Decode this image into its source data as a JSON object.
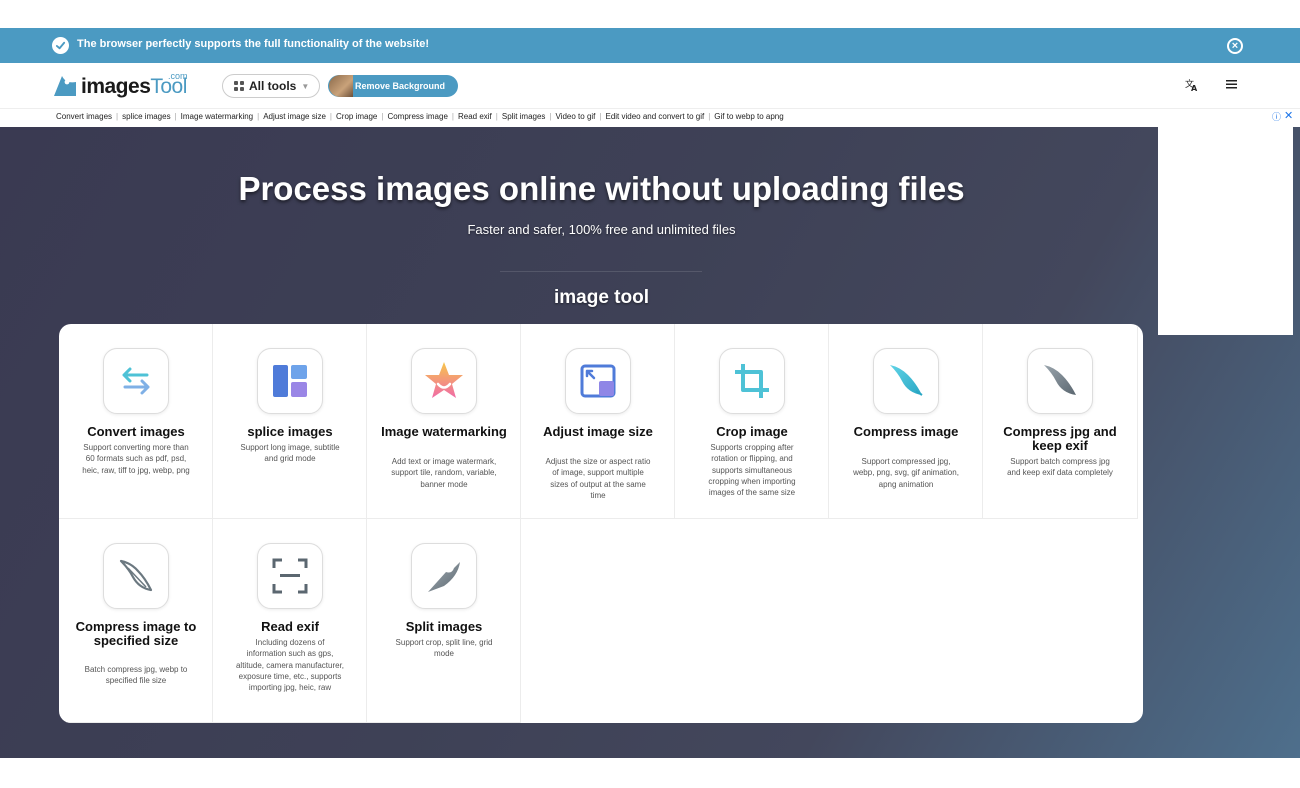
{
  "notice": {
    "message": "The browser perfectly supports the full functionality of the website!"
  },
  "header": {
    "logo": {
      "text_main": "images",
      "text_tool": "Tool",
      "text_com": ".com"
    },
    "all_tools_label": "All tools",
    "remove_background_label": "Remove Background"
  },
  "quicklinks": [
    "Convert images",
    "splice images",
    "Image watermarking",
    "Adjust image size",
    "Crop image",
    "Compress image",
    "Read exif",
    "Split images",
    "Video to gif",
    "Edit video and convert to gif",
    "Gif to webp to apng"
  ],
  "hero": {
    "title": "Process images online without uploading files",
    "subtitle": "Faster and safer, 100% free and unlimited files",
    "section_title": "image tool"
  },
  "tools": [
    {
      "name": "Convert images",
      "desc": "Support converting more than 60 formats such as pdf, psd, heic, raw, tiff to jpg, webp, png",
      "icon": "convert-arrows-icon"
    },
    {
      "name": "splice images",
      "desc": "Support long image, subtitle and grid mode",
      "icon": "splice-layout-icon"
    },
    {
      "name": "Image watermarking",
      "desc": "Add text or image watermark, support tile, random, variable, banner mode",
      "icon": "watermark-star-icon"
    },
    {
      "name": "Adjust image size",
      "desc": "Adjust the size or aspect ratio of image, support multiple sizes of output at the same time",
      "icon": "resize-icon"
    },
    {
      "name": "Crop image",
      "desc": "Supports cropping after rotation or flipping, and supports simultaneous cropping when importing images of the same size",
      "icon": "crop-icon"
    },
    {
      "name": "Compress image",
      "desc": "Support compressed jpg, webp, png, svg, gif animation, apng animation",
      "icon": "feather-icon"
    },
    {
      "name": "Compress jpg and keep exif",
      "desc": "Support batch compress jpg and keep exif data completely",
      "icon": "feather-gray-icon"
    },
    {
      "name": "Compress image to specified size",
      "desc": "Batch compress jpg, webp to specified file size",
      "icon": "feather-outline-icon"
    },
    {
      "name": "Read exif",
      "desc": "Including dozens of information such as gps, altitude, camera manufacturer, exposure time, etc., supports importing jpg, heic, raw",
      "icon": "scan-frame-icon"
    },
    {
      "name": "Split images",
      "desc": "Support crop, split line, grid mode",
      "icon": "knife-icon"
    }
  ],
  "colors": {
    "accent": "#4b9ac2",
    "hero_dark": "#3a3a52",
    "hero_light": "#4e6f8c"
  }
}
